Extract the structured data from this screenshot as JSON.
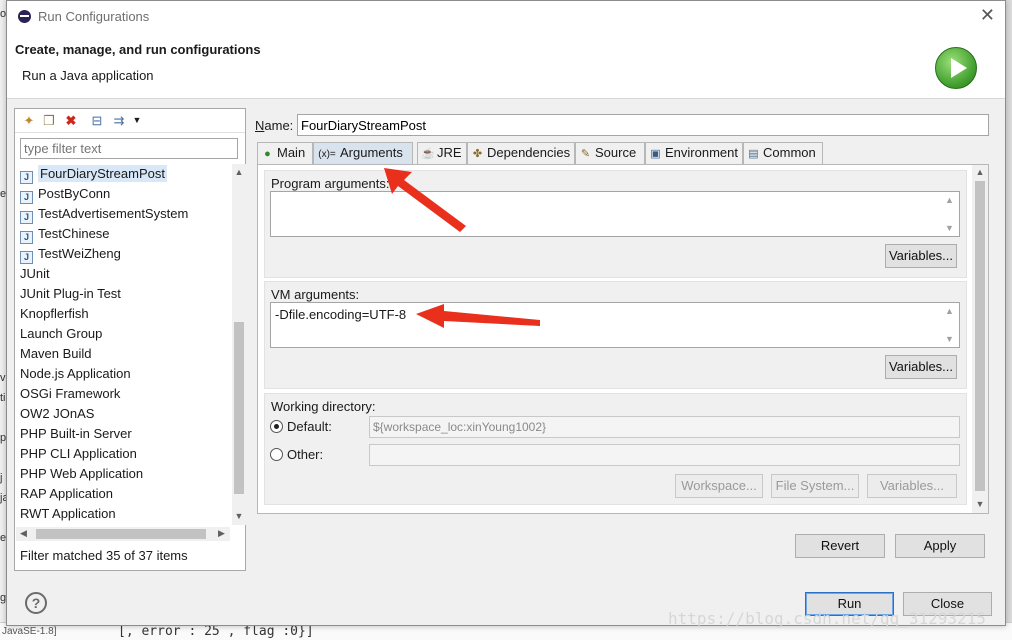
{
  "background": {
    "left_fragments": [
      "o",
      "er",
      "va",
      "ti",
      "pc",
      "j",
      "ja",
      "er",
      "g"
    ],
    "bottom_tab": "JavaSE-1.8]",
    "bottom_code": "[, error : 25 , flag :0}]"
  },
  "window": {
    "title": "Run Configurations",
    "close_glyph": "✕"
  },
  "header": {
    "title": "Create, manage, and run configurations",
    "subtitle": "Run a Java application"
  },
  "left_panel": {
    "toolbar_icons": [
      "new-config-icon",
      "duplicate-icon",
      "delete-icon",
      "collapse-all-icon",
      "filter-icon",
      "dropdown-icon"
    ],
    "filter_placeholder": "type filter text",
    "items": [
      {
        "label": "FourDiaryStreamPost",
        "icon": true,
        "selected": true
      },
      {
        "label": "PostByConn",
        "icon": true
      },
      {
        "label": "TestAdvertisementSystem",
        "icon": true
      },
      {
        "label": "TestChinese",
        "icon": true
      },
      {
        "label": "TestWeiZheng",
        "icon": true
      },
      {
        "label": "JUnit"
      },
      {
        "label": "JUnit Plug-in Test"
      },
      {
        "label": "Knopflerfish"
      },
      {
        "label": "Launch Group"
      },
      {
        "label": "Maven Build"
      },
      {
        "label": "Node.js Application"
      },
      {
        "label": "OSGi Framework"
      },
      {
        "label": "OW2 JOnAS"
      },
      {
        "label": "PHP Built-in Server"
      },
      {
        "label": "PHP CLI Application"
      },
      {
        "label": "PHP Web Application"
      },
      {
        "label": "RAP Application"
      },
      {
        "label": "RWT Application"
      }
    ],
    "status": "Filter matched 35 of 37 items"
  },
  "config": {
    "name_label": "Name:",
    "name_value": "FourDiaryStreamPost",
    "tabs": [
      {
        "label": "Main",
        "icon": "main-icon",
        "glyph": "●"
      },
      {
        "label": "Arguments",
        "icon": "arguments-icon",
        "glyph": "(x)=",
        "active": true
      },
      {
        "label": "JRE",
        "icon": "jre-icon",
        "glyph": "☕"
      },
      {
        "label": "Dependencies",
        "icon": "dependencies-icon",
        "glyph": "✤"
      },
      {
        "label": "Source",
        "icon": "source-icon",
        "glyph": "✎"
      },
      {
        "label": "Environment",
        "icon": "environment-icon",
        "glyph": "▣"
      },
      {
        "label": "Common",
        "icon": "common-icon",
        "glyph": "▤"
      }
    ],
    "program_args": {
      "label": "Program arguments:",
      "value": "",
      "variables": "Variables..."
    },
    "vm_args": {
      "label": "VM arguments:",
      "value": "-Dfile.encoding=UTF-8",
      "variables": "Variables..."
    },
    "working_dir": {
      "label": "Working directory:",
      "default_label": "Default:",
      "default_value": "${workspace_loc:xinYoung1002}",
      "other_label": "Other:",
      "other_value": "",
      "workspace_btn": "Workspace...",
      "filesystem_btn": "File System...",
      "variables_btn": "Variables..."
    },
    "revert": "Revert",
    "apply": "Apply"
  },
  "footer": {
    "help_glyph": "?",
    "run": "Run",
    "close": "Close"
  },
  "watermark": "https://blog.csdn.net/qq_31293215",
  "colors": {
    "arrow": "#e8301c",
    "selection": "#d9e8f9",
    "run_icon": "#3c9a2a"
  }
}
